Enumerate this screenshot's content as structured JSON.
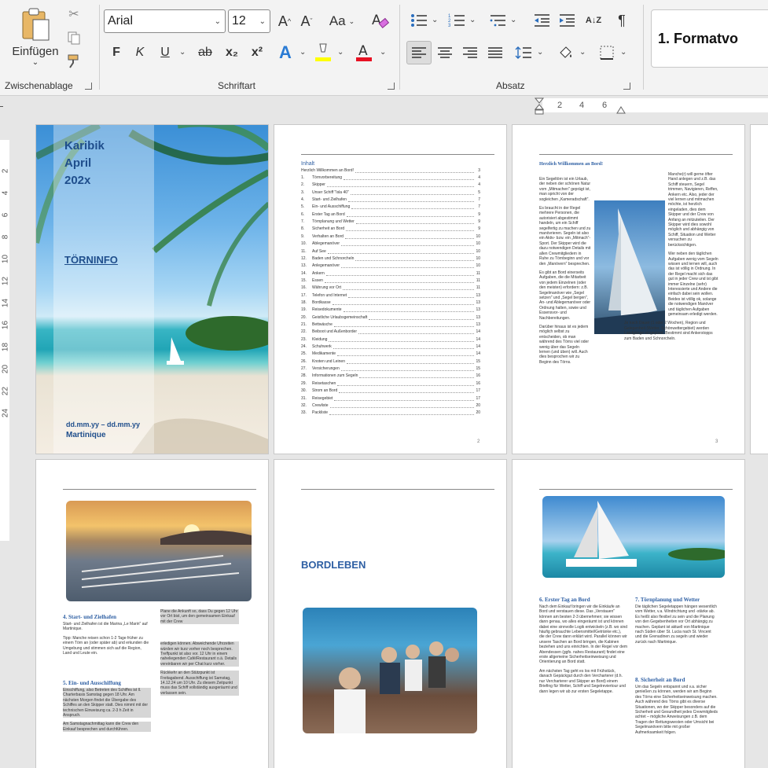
{
  "ribbon": {
    "clipboard": {
      "label": "Zwischenablage",
      "paste_label": "Einfügen"
    },
    "font": {
      "label": "Schriftart",
      "font_name": "Arial",
      "font_size": "12",
      "bold": "F",
      "italic": "K",
      "underline": "U",
      "strike": "ab",
      "subscript": "x₂",
      "superscript": "x²",
      "grow": "A^",
      "shrink": "Aˇ",
      "case": "Aa"
    },
    "paragraph": {
      "label": "Absatz",
      "sort": "A↓Z",
      "pilcrow": "¶"
    },
    "styles": {
      "preview": "1.  Formatvo"
    },
    "colors": {
      "highlight": "#ffff00",
      "font_color": "#e81123",
      "accent": "#1f4e8c"
    }
  },
  "ruler": {
    "h_numbers": [
      "2",
      "4",
      "6"
    ],
    "v_numbers": [
      "2",
      "4",
      "6",
      "8",
      "10",
      "12",
      "14",
      "16",
      "18",
      "20",
      "22",
      "24"
    ]
  },
  "page1": {
    "line1": "Karibik",
    "line2": "April",
    "line3": "202x",
    "title": "TÖRNINFO",
    "dates": "dd.mm.yy – dd.mm.yy",
    "place": "Martinique"
  },
  "page2": {
    "heading": "Inhalt",
    "intro": "Herzlich Willkommen an Bord!",
    "intro_page": "3",
    "toc": [
      {
        "n": "1.",
        "t": "Törnvorbereitung",
        "p": "4"
      },
      {
        "n": "2.",
        "t": "Skipper",
        "p": "4"
      },
      {
        "n": "3.",
        "t": "Unser Schiff \"Isla 40\"",
        "p": "5"
      },
      {
        "n": "4.",
        "t": "Start- und Zielhafen",
        "p": "7"
      },
      {
        "n": "5.",
        "t": "Ein- und Ausschiffung",
        "p": "7"
      },
      {
        "n": "6.",
        "t": "Erster Tag an Bord",
        "p": "9"
      },
      {
        "n": "7.",
        "t": "Törnplanung und Wetter",
        "p": "9"
      },
      {
        "n": "8.",
        "t": "Sicherheit an Bord",
        "p": "9"
      },
      {
        "n": "9.",
        "t": "Verhalten an Bord",
        "p": "10"
      },
      {
        "n": "10.",
        "t": "Ablegemanöver",
        "p": "10"
      },
      {
        "n": "11.",
        "t": "Auf See",
        "p": "10"
      },
      {
        "n": "12.",
        "t": "Baden und Schnorcheln",
        "p": "10"
      },
      {
        "n": "13.",
        "t": "Anlegemanöver",
        "p": "10"
      },
      {
        "n": "14.",
        "t": "Ankern",
        "p": "11"
      },
      {
        "n": "15.",
        "t": "Essen",
        "p": "11"
      },
      {
        "n": "16.",
        "t": "Währung vor Ort",
        "p": "11"
      },
      {
        "n": "17.",
        "t": "Telefon und Internet",
        "p": "13"
      },
      {
        "n": "18.",
        "t": "Bordkasse",
        "p": "13"
      },
      {
        "n": "19.",
        "t": "Reisedokumente",
        "p": "13"
      },
      {
        "n": "20.",
        "t": "Geistliche Urlaubsgemeinschaft",
        "p": "13"
      },
      {
        "n": "21.",
        "t": "Bettwäsche",
        "p": "13"
      },
      {
        "n": "22.",
        "t": "Beiboot und Außenborder",
        "p": "14"
      },
      {
        "n": "23.",
        "t": "Kleidung",
        "p": "14"
      },
      {
        "n": "24.",
        "t": "Schuhwerk",
        "p": "14"
      },
      {
        "n": "25.",
        "t": "Medikamente",
        "p": "14"
      },
      {
        "n": "26.",
        "t": "Knoten und Leinen",
        "p": "15"
      },
      {
        "n": "27.",
        "t": "Versicherungen",
        "p": "15"
      },
      {
        "n": "28.",
        "t": "Informationen zum Segeln",
        "p": "16"
      },
      {
        "n": "29.",
        "t": "Reisetaschen",
        "p": "16"
      },
      {
        "n": "30.",
        "t": "Strom an Bord",
        "p": "17"
      },
      {
        "n": "31.",
        "t": "Reisegebiet",
        "p": "17"
      },
      {
        "n": "32.",
        "t": "Crewliste",
        "p": "20"
      },
      {
        "n": "33.",
        "t": "Packliste",
        "p": "20"
      }
    ],
    "page_number": "2"
  },
  "page3": {
    "heading": "Herzlich Willkommen an Bord!",
    "col1": [
      "Ein Segeltörn ist ein Urlaub, der neben der schönen Natur vom „Mitmachen\" geprägt ist, man spricht von der sogleichen „Kameradschaft\".",
      "Es braucht in der Regel mehrere Personen, die autorisiert abgestimmt handeln, um ein Schiff segelfertig zu machen und zu manövrieren. Segeln ist also ein Aktiv- bzw. ein „Mitmach\"-Sport. Der Skipper wird die dazu notwendigen Details mit allen Crewmitgliedern in Ruhe zu Törnbeginn und vor den „Manövern\" besprechen.",
      "Es gibt an Bord einerseits Aufgaben, die die Mitarbeit von jedem Einzelnen (oder den meisten) erfordern: z.B. Segelmanöver wie „Segel setzen\" und „Segel bergen\", An- und Ablegemanöver oder Ordnung halten, sowie und Essensvor- und Nachbereitungen.",
      "Darüber hinaus ist es jedem möglich selbst zu entscheiden, ob man während des Törns viel oder wenig über das Segeln lernen (und üben) will. Auch dies besprochen wir zu Beginn des Törns."
    ],
    "col2": [
      "Manche(r) will gerne öfter Hand anlegen und z.B. das Schiff steuern, Segel trimmen, Navigieren, Reffen, Ankern etc. Also, jeder der viel lernen und mitmachen möchte, ist herzlich eingeladen, dies dem Skipper und der Crew von Anfang an mitzuteilen. Der Skipper wird dies sowohl möglich und abhängig von Schiff, Situation und Wetter versuchen zu berücksichtigen.",
      "Wer neben den täglichen Aufgaben wenig vom Segeln wissen und lernen will, auch das ist völlig in Ordnung. In der Regel macht sich das gut in jeder Crew und ist gibt immer Einzelne (sehr) Interessierte und Andere die einfach dabei sein wollen. Beides ist völlig ok, solange die notwendigen Manöver und täglichen Aufgaben gemeinsam erledigt werden.",
      "Je nach Dauer (1 oder 2 Wochen), Region und Gelegenheit (Wetter, Schönwettergebiet) werden Landgänge eingeplant. Bestimmt sind Ankerstopps zum Baden und Schnorcheln."
    ],
    "page_number": "3"
  },
  "page4": {
    "h4": "4. Start- und Zielhafen",
    "p4a": "Start- und Zielhafen ist die Marina „Le Marin\" auf Martinique.",
    "p4b": "Tipp: Manche reisen schon 1-2 Tage früher zu einem Törn an (oder später ab) und erkunden die Umgebung und stimmen sich auf die Region, Land und Leute ein.",
    "h5": "5. Ein- und Ausschiffung",
    "p5a": "Einschiffung, also Betreten des Schiffes ist ll. Charterbasis Samstag gegen 18 Uhr. Am nächsten Morgen findet die Übergabe des Schiffes an den Skipper statt. Dies nimmt mit der technischen Einweisung ca. 2-3 h Zeit in Anspruch.",
    "p5b": "Am Samstagnachmittag kann die Crew den Einkauf besprechen und durchführen.",
    "c2a": "Plane die Ankunft so, dass Du gegen 12 Uhr vor Ort bist, um den gemeinsamen Einkauf mit der Crew",
    "c2b": "erledigen können. Abweichende Uhrzeiten würden wir kurz vorher noch besprechen. Treffpunkt ist also vor. 12 Uhr in einem naheliegenden Café/Restaurant o.ä. Details vereinbaren wir per Chat kurz vorher.",
    "c2c": "Rückkehr an den Stützpunkt ist Freitagabend. Ausschiffung ist Samstag, 14.12.24 um 10 Uhr. Zu diesem Zeitpunkt muss das Schiff vollständig ausgeräumt und verlassen sein."
  },
  "page5": {
    "title": "BORDLEBEN"
  },
  "page6": {
    "h6": "6. Erster Tag an Bord",
    "p6": "Nach dem Einkauf bringen wir die Einkäufe an Bord und verstauen diese. Das „Verstauen\" können am besten 2-3 übernehmen; sie wissen dann genau, wo alles eingeräumt ist und können dabei eine sinnvolle Logik entwickeln (z.B. wo sind häufig gebrauchte Lebensmittel/Getränke etc.), die der Crew dann erklärt wird. Parallel können wir unsere Taschen an Bord bringen, die Kabinen beziehen und uns einrichten. In der Regel vor dem Abendessen (ggfs. nahes Restaurant) findet eine erste allgemeine Sicherheitseinweisung und Orientierung an Bord statt.",
    "p6b": "Am nächsten Tag geht es los mit Frühstück, danach Gepäckgut durch den Vercharterer (d.h. nur Vercharterer und Skipper an Bord) einem Briefing für Wetter, Schiff und Segelreviertour und dann legen wir ab zur ersten Segeletappe.",
    "h7": "7. Törnplanung und Wetter",
    "p7": "Die täglichen Segeletappen hängen wesentlich vom Wetter, v.a. Windrichtung und -stärke ab. Es heißt also flexibel zu sein und die Planung von den Gegebenheiten vor Ort abhängig zu machen. Geplant ist aktuell von Martinique nach Süden über St. Lucia nach St. Vincent und die Grenadinen zu segeln und wieder zurück nach Martinique.",
    "h8": "8. Sicherheit an Bord",
    "p8": "Um das Segeln entspannt und v.a. sicher genießen zu können, werden wir am Beginn des Törns eine Sicherheitseinweisung machen. Auch während des Törns gibt es diverse Situationen, wo der Skipper besonders auf die Sicherheit und Gesundheit jedes Crewmitglieds achtet – mögliche Anweisungen z.B. dem Tragen der Rettungswesten oder Umsicht bei Segelmanövern bitte mit großer Aufmerksamkeit folgen."
  }
}
